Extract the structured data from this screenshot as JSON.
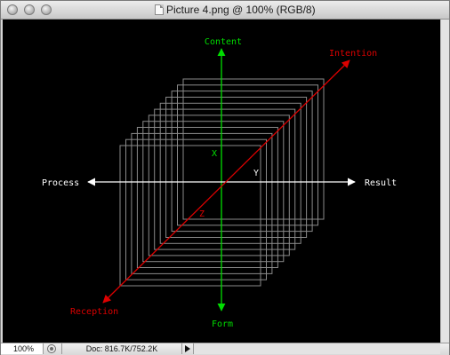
{
  "window": {
    "title": "Picture 4.png @ 100% (RGB/8)"
  },
  "diagram": {
    "axis_labels": {
      "content": "Content",
      "form": "Form",
      "process": "Process",
      "result": "Result",
      "intention": "Intention",
      "reception": "Reception",
      "x": "X",
      "y": "Y",
      "z": "Z"
    },
    "frame_count": 12,
    "colors": {
      "background": "#000000",
      "vertical_axis": "#00dd00",
      "horizontal_axis": "#ffffff",
      "diagonal_axis": "#dd0000",
      "frames": "#8a8a8a"
    }
  },
  "statusbar": {
    "zoom": "100%",
    "doc_size": "Doc: 816.7K/752.2K"
  },
  "icons": {
    "close": "close-button-icon",
    "minimize": "minimize-button-icon",
    "zoom": "zoom-button-icon",
    "document": "document-icon",
    "status": "status-info-icon",
    "arrow": "triangle-right-icon"
  }
}
